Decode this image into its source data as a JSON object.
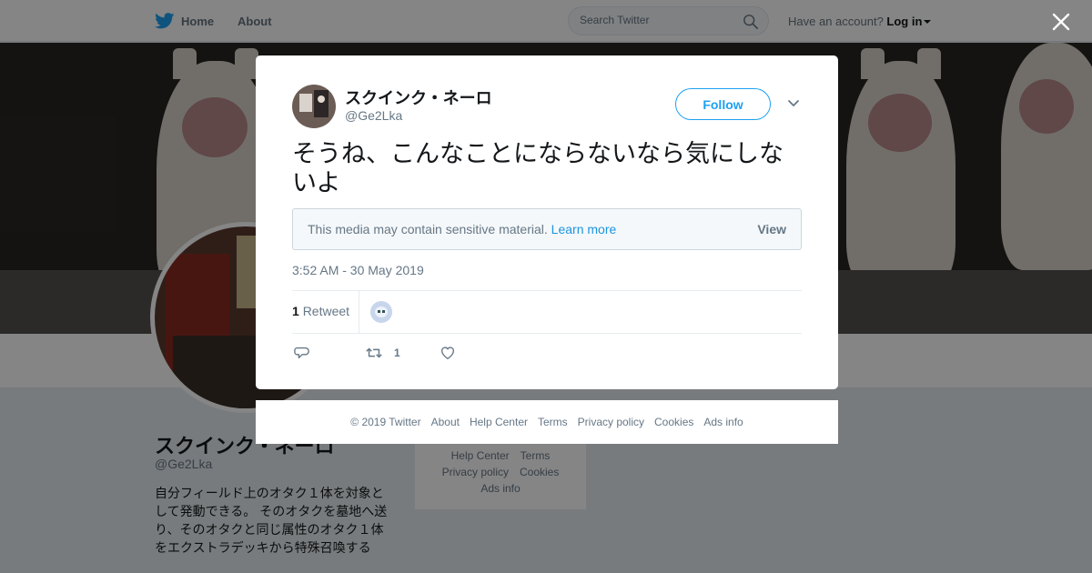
{
  "nav": {
    "home_label": "Home",
    "about_label": "About",
    "search_placeholder": "Search Twitter",
    "account_prompt": "Have an account?",
    "login_label": "Log in"
  },
  "profile": {
    "name": "スクインク・ネーロ",
    "handle": "@Ge2Lka",
    "bio": "自分フィールド上のオタク１体を対象として発動できる。 そのオタクを墓地へ送り、そのオタクと同じ属性のオタク１体をエクストラデッキから特殊召喚する"
  },
  "side_footer": {
    "row1": [
      "Help Center",
      "Terms"
    ],
    "row2": [
      "Privacy policy",
      "Cookies"
    ],
    "row3": [
      "Ads info"
    ]
  },
  "tweet": {
    "author_name": "スクインク・ネーロ",
    "author_handle": "@Ge2Lka",
    "follow_label": "Follow",
    "text": "そうね、こんなことにならないなら気にしないよ",
    "sensitive_message": "This media may contain sensitive material.",
    "learn_more_label": "Learn more",
    "view_label": "View",
    "timestamp": "3:52 AM - 30 May 2019",
    "retweet_count": "1",
    "retweet_label": "Retweet",
    "action_retweet_count": "1"
  },
  "footer": {
    "copyright": "© 2019 Twitter",
    "links": [
      "About",
      "Help Center",
      "Terms",
      "Privacy policy",
      "Cookies",
      "Ads info"
    ]
  },
  "icons": {
    "brand": "twitter-bird-icon",
    "search": "search-icon",
    "close": "close-icon",
    "caret": "chevron-down-icon",
    "reply": "reply-icon",
    "retweet": "retweet-icon",
    "like": "heart-icon"
  },
  "colors": {
    "accent": "#1da1f2",
    "link": "#1b95e0",
    "muted_text": "#657786",
    "overlay": "rgba(0,0,0,0.48)"
  }
}
